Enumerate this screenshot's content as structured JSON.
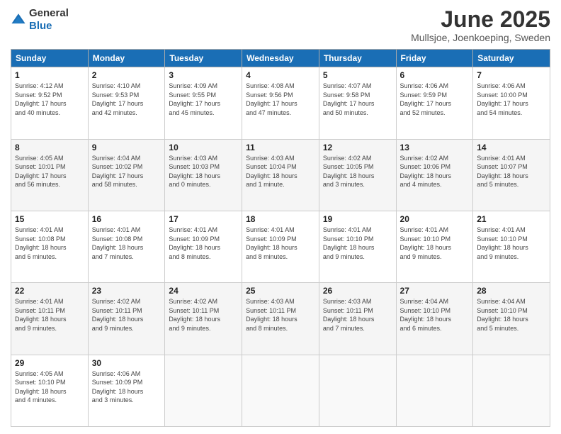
{
  "logo": {
    "text_general": "General",
    "text_blue": "Blue"
  },
  "header": {
    "title": "June 2025",
    "subtitle": "Mullsjoe, Joenkoeping, Sweden"
  },
  "columns": [
    "Sunday",
    "Monday",
    "Tuesday",
    "Wednesday",
    "Thursday",
    "Friday",
    "Saturday"
  ],
  "weeks": [
    [
      {
        "day": "1",
        "info": "Sunrise: 4:12 AM\nSunset: 9:52 PM\nDaylight: 17 hours\nand 40 minutes."
      },
      {
        "day": "2",
        "info": "Sunrise: 4:10 AM\nSunset: 9:53 PM\nDaylight: 17 hours\nand 42 minutes."
      },
      {
        "day": "3",
        "info": "Sunrise: 4:09 AM\nSunset: 9:55 PM\nDaylight: 17 hours\nand 45 minutes."
      },
      {
        "day": "4",
        "info": "Sunrise: 4:08 AM\nSunset: 9:56 PM\nDaylight: 17 hours\nand 47 minutes."
      },
      {
        "day": "5",
        "info": "Sunrise: 4:07 AM\nSunset: 9:58 PM\nDaylight: 17 hours\nand 50 minutes."
      },
      {
        "day": "6",
        "info": "Sunrise: 4:06 AM\nSunset: 9:59 PM\nDaylight: 17 hours\nand 52 minutes."
      },
      {
        "day": "7",
        "info": "Sunrise: 4:06 AM\nSunset: 10:00 PM\nDaylight: 17 hours\nand 54 minutes."
      }
    ],
    [
      {
        "day": "8",
        "info": "Sunrise: 4:05 AM\nSunset: 10:01 PM\nDaylight: 17 hours\nand 56 minutes."
      },
      {
        "day": "9",
        "info": "Sunrise: 4:04 AM\nSunset: 10:02 PM\nDaylight: 17 hours\nand 58 minutes."
      },
      {
        "day": "10",
        "info": "Sunrise: 4:03 AM\nSunset: 10:03 PM\nDaylight: 18 hours\nand 0 minutes."
      },
      {
        "day": "11",
        "info": "Sunrise: 4:03 AM\nSunset: 10:04 PM\nDaylight: 18 hours\nand 1 minute."
      },
      {
        "day": "12",
        "info": "Sunrise: 4:02 AM\nSunset: 10:05 PM\nDaylight: 18 hours\nand 3 minutes."
      },
      {
        "day": "13",
        "info": "Sunrise: 4:02 AM\nSunset: 10:06 PM\nDaylight: 18 hours\nand 4 minutes."
      },
      {
        "day": "14",
        "info": "Sunrise: 4:01 AM\nSunset: 10:07 PM\nDaylight: 18 hours\nand 5 minutes."
      }
    ],
    [
      {
        "day": "15",
        "info": "Sunrise: 4:01 AM\nSunset: 10:08 PM\nDaylight: 18 hours\nand 6 minutes."
      },
      {
        "day": "16",
        "info": "Sunrise: 4:01 AM\nSunset: 10:08 PM\nDaylight: 18 hours\nand 7 minutes."
      },
      {
        "day": "17",
        "info": "Sunrise: 4:01 AM\nSunset: 10:09 PM\nDaylight: 18 hours\nand 8 minutes."
      },
      {
        "day": "18",
        "info": "Sunrise: 4:01 AM\nSunset: 10:09 PM\nDaylight: 18 hours\nand 8 minutes."
      },
      {
        "day": "19",
        "info": "Sunrise: 4:01 AM\nSunset: 10:10 PM\nDaylight: 18 hours\nand 9 minutes."
      },
      {
        "day": "20",
        "info": "Sunrise: 4:01 AM\nSunset: 10:10 PM\nDaylight: 18 hours\nand 9 minutes."
      },
      {
        "day": "21",
        "info": "Sunrise: 4:01 AM\nSunset: 10:10 PM\nDaylight: 18 hours\nand 9 minutes."
      }
    ],
    [
      {
        "day": "22",
        "info": "Sunrise: 4:01 AM\nSunset: 10:11 PM\nDaylight: 18 hours\nand 9 minutes."
      },
      {
        "day": "23",
        "info": "Sunrise: 4:02 AM\nSunset: 10:11 PM\nDaylight: 18 hours\nand 9 minutes."
      },
      {
        "day": "24",
        "info": "Sunrise: 4:02 AM\nSunset: 10:11 PM\nDaylight: 18 hours\nand 9 minutes."
      },
      {
        "day": "25",
        "info": "Sunrise: 4:03 AM\nSunset: 10:11 PM\nDaylight: 18 hours\nand 8 minutes."
      },
      {
        "day": "26",
        "info": "Sunrise: 4:03 AM\nSunset: 10:11 PM\nDaylight: 18 hours\nand 7 minutes."
      },
      {
        "day": "27",
        "info": "Sunrise: 4:04 AM\nSunset: 10:10 PM\nDaylight: 18 hours\nand 6 minutes."
      },
      {
        "day": "28",
        "info": "Sunrise: 4:04 AM\nSunset: 10:10 PM\nDaylight: 18 hours\nand 5 minutes."
      }
    ],
    [
      {
        "day": "29",
        "info": "Sunrise: 4:05 AM\nSunset: 10:10 PM\nDaylight: 18 hours\nand 4 minutes."
      },
      {
        "day": "30",
        "info": "Sunrise: 4:06 AM\nSunset: 10:09 PM\nDaylight: 18 hours\nand 3 minutes."
      },
      {
        "day": "",
        "info": ""
      },
      {
        "day": "",
        "info": ""
      },
      {
        "day": "",
        "info": ""
      },
      {
        "day": "",
        "info": ""
      },
      {
        "day": "",
        "info": ""
      }
    ]
  ]
}
